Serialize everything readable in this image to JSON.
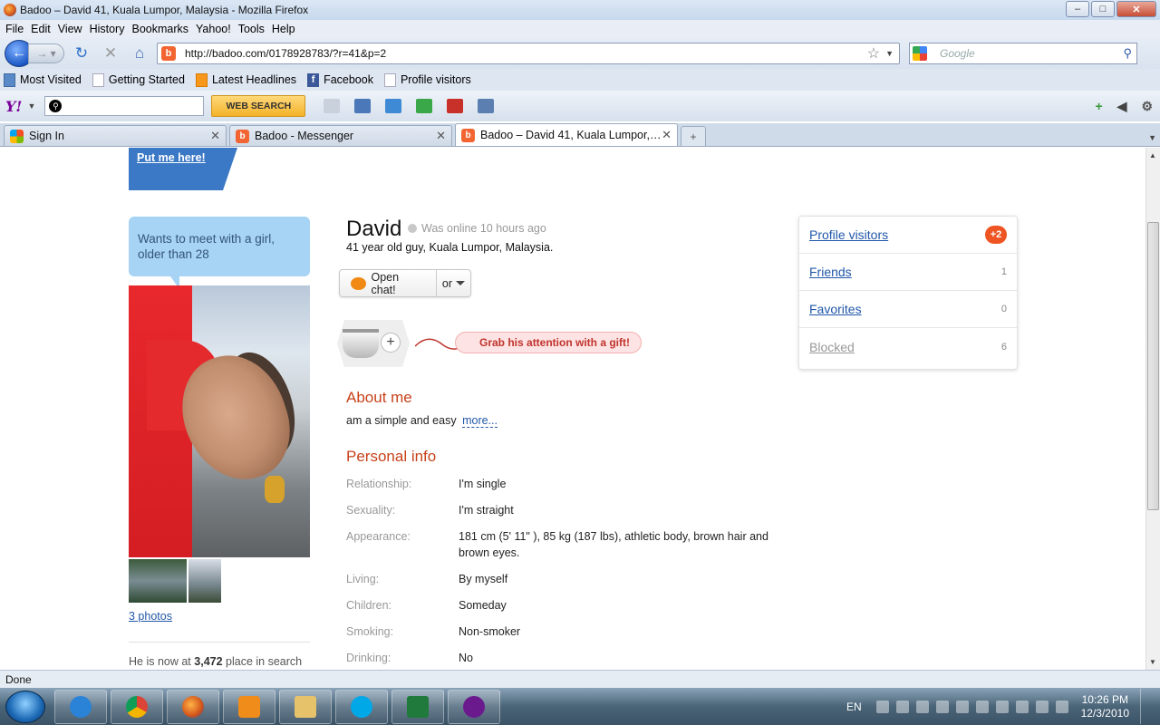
{
  "window": {
    "title": "Badoo – David 41, Kuala Lumpor, Malaysia - Mozilla Firefox"
  },
  "menu": [
    "File",
    "Edit",
    "View",
    "History",
    "Bookmarks",
    "Yahoo!",
    "Tools",
    "Help"
  ],
  "nav": {
    "url": "http://badoo.com/0178928783/?r=41&p=2",
    "search_placeholder": "Google"
  },
  "bookmarks": [
    "Most Visited",
    "Getting Started",
    "Latest Headlines",
    "Facebook",
    "Profile visitors"
  ],
  "yahoo": {
    "logo": "Y!",
    "web_search": "WEB SEARCH"
  },
  "tabs": [
    {
      "label": "Sign In"
    },
    {
      "label": "Badoo - Messenger"
    },
    {
      "label": "Badoo – David 41, Kuala Lumpor, ..."
    }
  ],
  "page": {
    "put_me_here": "Put me here!",
    "bubble": "Wants to meet with a girl, older than 28",
    "photos_link": "3 photos",
    "rank_prefix": "He is now at",
    "rank_number": "3,472",
    "rank_suffix": "place in search",
    "name": "David",
    "online": "Was online 10 hours ago",
    "subinfo": "41 year old guy, Kuala Lumpor, Malaysia.",
    "open_chat": "Open chat!",
    "or": "or",
    "gift": "Grab his attention with a gift!",
    "about_title": "About me",
    "about_text": "am a simple and easy",
    "about_more": "more...",
    "personal_title": "Personal info",
    "personal": [
      {
        "label": "Relationship:",
        "value": "I'm single"
      },
      {
        "label": "Sexuality:",
        "value": "I'm straight"
      },
      {
        "label": "Appearance:",
        "value": "181 cm (5' 11\" ), 85 kg (187 lbs), athletic body, brown hair and brown eyes."
      },
      {
        "label": "Living:",
        "value": "By myself"
      },
      {
        "label": "Children:",
        "value": "Someday"
      },
      {
        "label": "Smoking:",
        "value": "Non-smoker"
      },
      {
        "label": "Drinking:",
        "value": "No"
      }
    ],
    "sidebox": [
      {
        "label": "Profile visitors",
        "count": "+2"
      },
      {
        "label": "Friends",
        "count": "1"
      },
      {
        "label": "Favorites",
        "count": "0"
      },
      {
        "label": "Blocked",
        "count": "6"
      }
    ]
  },
  "status": "Done",
  "taskbar": {
    "lang": "EN",
    "time": "10:26 PM",
    "date": "12/3/2010"
  }
}
